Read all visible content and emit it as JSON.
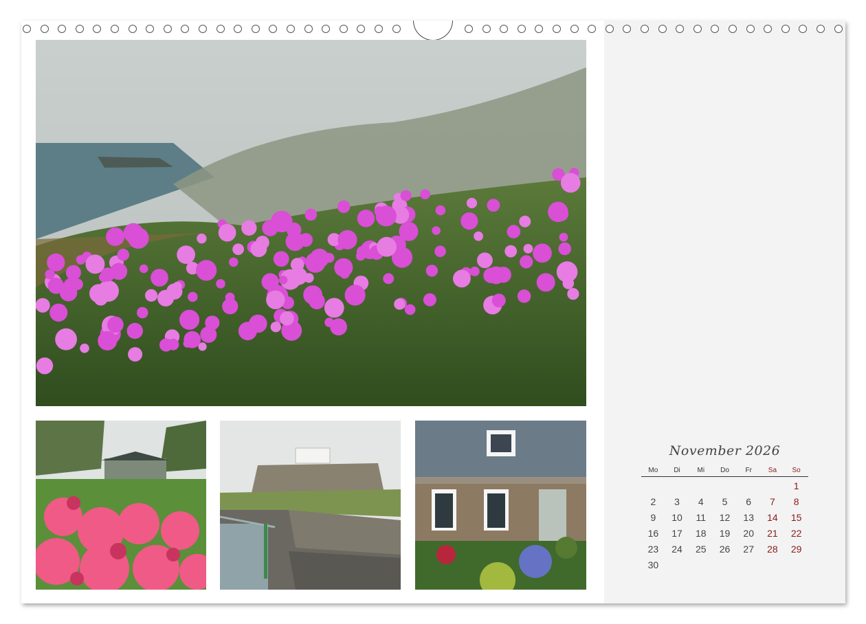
{
  "calendar": {
    "title": "November 2026",
    "weekdays": [
      "Mo",
      "Di",
      "Mi",
      "Do",
      "Fr",
      "Sa",
      "So"
    ],
    "days": [
      "",
      "",
      "",
      "",
      "",
      "",
      "1",
      "2",
      "3",
      "4",
      "5",
      "6",
      "7",
      "8",
      "9",
      "10",
      "11",
      "12",
      "13",
      "14",
      "15",
      "16",
      "17",
      "18",
      "19",
      "20",
      "21",
      "22",
      "23",
      "24",
      "25",
      "26",
      "27",
      "28",
      "29",
      "30",
      "",
      "",
      "",
      "",
      "",
      ""
    ],
    "weekend_color": "#8b1a1a"
  },
  "photos": {
    "main": "sea-thrift-cliffs-photo",
    "bottom_left": "azalea-garden-photo",
    "bottom_middle": "coastal-fort-photo",
    "bottom_right": "stone-cottage-photo"
  }
}
